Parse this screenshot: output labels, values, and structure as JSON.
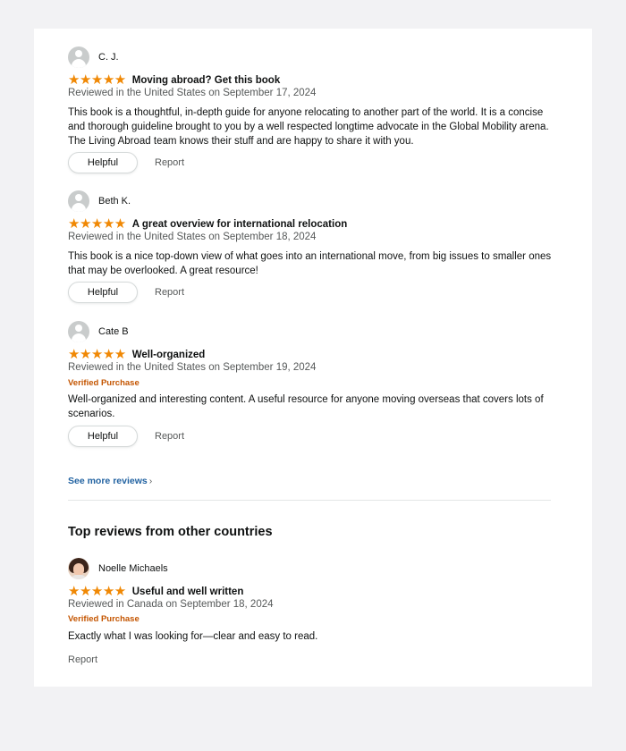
{
  "reviews": [
    {
      "name": "C. J.",
      "stars": "★★★★★",
      "title": "Moving abroad? Get this book",
      "meta": "Reviewed in the United States on September 17, 2024",
      "body": "This book is a thoughtful, in-depth guide for anyone relocating to another part of the world. It is a concise and thorough guideline brought to you by a well respected longtime advocate in the Global Mobility arena. The Living Abroad team knows their stuff and are happy to share it with you.",
      "helpful": "Helpful",
      "report": "Report"
    },
    {
      "name": "Beth K.",
      "stars": "★★★★★",
      "title": "A great overview for international relocation",
      "meta": "Reviewed in the United States on September 18, 2024",
      "body": "This book is a nice top-down view of what goes into an international move, from big issues to smaller ones that may be overlooked. A great resource!",
      "helpful": "Helpful",
      "report": "Report"
    },
    {
      "name": "Cate B",
      "stars": "★★★★★",
      "title": "Well-organized",
      "meta": "Reviewed in the United States on September 19, 2024",
      "verified": "Verified Purchase",
      "body": "Well-organized and interesting content. A useful resource for anyone moving overseas that covers lots of scenarios.",
      "helpful": "Helpful",
      "report": "Report"
    }
  ],
  "see_more": "See more reviews",
  "see_more_chevron": "›",
  "other_countries": {
    "heading": "Top reviews from other countries",
    "review": {
      "name": "Noelle Michaels",
      "stars": "★★★★★",
      "title": "Useful and well written",
      "meta": "Reviewed in Canada on September 18, 2024",
      "verified": "Verified Purchase",
      "body": "Exactly what I was looking for—clear and easy to read.",
      "report": "Report"
    }
  },
  "colors": {
    "star": "#f08804",
    "link": "#2162a1",
    "verified": "#c45500",
    "muted": "#565959"
  }
}
